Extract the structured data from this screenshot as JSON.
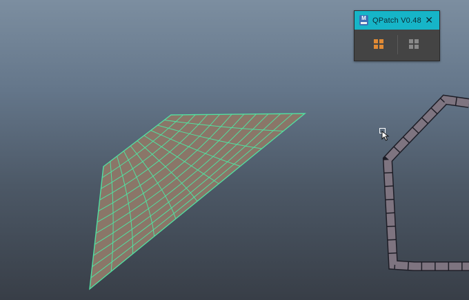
{
  "window": {
    "title": "QPatch V0.48",
    "logo_letter": "M",
    "close_glyph": "✕",
    "titlebar_color": "#16b5c8"
  },
  "tools": [
    {
      "name": "patch-fill-button",
      "icon": "grid-quad-icon",
      "color": "#e08a35"
    },
    {
      "name": "patch-grid-button",
      "icon": "grid-quad-icon",
      "color": "#8a8a8a"
    }
  ],
  "viewport": {
    "mesh_fill": "#8a7668",
    "wire_color": "#52e0a0",
    "border_fill": "#7e7480"
  }
}
